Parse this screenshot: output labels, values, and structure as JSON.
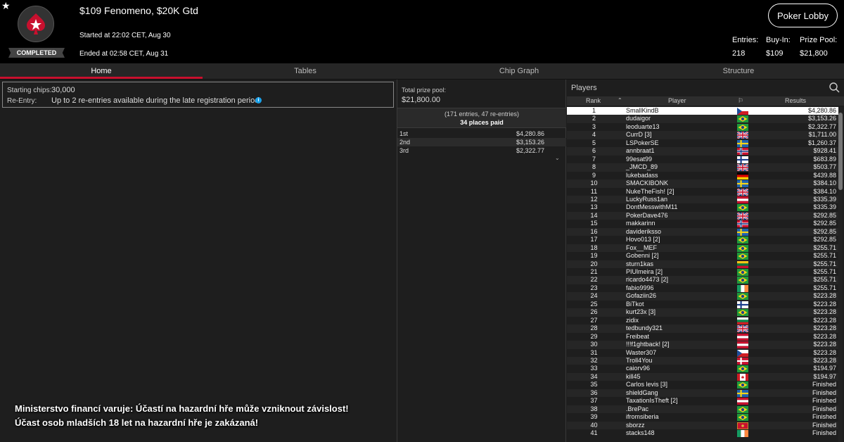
{
  "header": {
    "badge": "COMPLETED",
    "title": "$109 Fenomeno, $20K Gtd",
    "started": "Started at 22:02 CET, Aug 30",
    "ended": "Ended at 02:58 CET, Aug 31",
    "lobby_button": "Poker Lobby",
    "stats": [
      {
        "label": "Entries:",
        "value": "218"
      },
      {
        "label": "Buy-In:",
        "value": "$109"
      },
      {
        "label": "Prize Pool:",
        "value": "$21,800"
      }
    ]
  },
  "tabs": [
    "Home",
    "Tables",
    "Chip Graph",
    "Structure"
  ],
  "info": {
    "starting_chips_label": "Starting chips:",
    "starting_chips_value": "30,000",
    "reentry_label": "Re-Entry:",
    "reentry_value": "Up to 2 re-entries available during the late registration period."
  },
  "prize": {
    "label": "Total prize pool:",
    "value": "$21,800.00",
    "entries": "(171 entries, 47 re-entries)",
    "places": "34 places paid",
    "payouts": [
      {
        "place": "1st",
        "amount": "$4,280.86"
      },
      {
        "place": "2nd",
        "amount": "$3,153.26"
      },
      {
        "place": "3rd",
        "amount": "$2,322.77"
      }
    ]
  },
  "players": {
    "label": "Players",
    "col_rank": "Rank",
    "col_player": "Player",
    "col_results": "Results",
    "rows": [
      {
        "rank": "1",
        "name": "SmallKindB",
        "flag": "cz",
        "result": "$4,280.86"
      },
      {
        "rank": "2",
        "name": "dudaigor",
        "flag": "br",
        "result": "$3,153.26"
      },
      {
        "rank": "3",
        "name": "leoduarte13",
        "flag": "br",
        "result": "$2,322.77"
      },
      {
        "rank": "4",
        "name": "CurrD [3]",
        "flag": "gb",
        "result": "$1,711.00"
      },
      {
        "rank": "5",
        "name": "LSPokerSE",
        "flag": "se",
        "result": "$1,260.37"
      },
      {
        "rank": "6",
        "name": "annbraat1",
        "flag": "no",
        "result": "$928.41"
      },
      {
        "rank": "7",
        "name": "99esat99",
        "flag": "fi",
        "result": "$683.89"
      },
      {
        "rank": "8",
        "name": "_JMCD_89",
        "flag": "gb",
        "result": "$503.77"
      },
      {
        "rank": "9",
        "name": "lukebadass",
        "flag": "de",
        "result": "$439.88"
      },
      {
        "rank": "10",
        "name": "SMACKIBONK",
        "flag": "se",
        "result": "$384.10"
      },
      {
        "rank": "11",
        "name": "NukeTheFish! [2]",
        "flag": "gb",
        "result": "$384.10"
      },
      {
        "rank": "12",
        "name": "LuckyRuss1an",
        "flag": "at",
        "result": "$335.39"
      },
      {
        "rank": "13",
        "name": "DontMesswithM11",
        "flag": "br",
        "result": "$335.39"
      },
      {
        "rank": "14",
        "name": "PokerDave476",
        "flag": "gb",
        "result": "$292.85"
      },
      {
        "rank": "15",
        "name": "makkarinn",
        "flag": "no",
        "result": "$292.85"
      },
      {
        "rank": "16",
        "name": "davideriksso",
        "flag": "se",
        "result": "$292.85"
      },
      {
        "rank": "17",
        "name": "Hovo013 [2]",
        "flag": "br",
        "result": "$292.85"
      },
      {
        "rank": "18",
        "name": "Fox__MEF",
        "flag": "br",
        "result": "$255.71"
      },
      {
        "rank": "19",
        "name": "Gobenni [2]",
        "flag": "br",
        "result": "$255.71"
      },
      {
        "rank": "20",
        "name": "sturn1kas",
        "flag": "lt",
        "result": "$255.71"
      },
      {
        "rank": "21",
        "name": "PIUlmeira [2]",
        "flag": "br",
        "result": "$255.71"
      },
      {
        "rank": "22",
        "name": "ricardo4473 [2]",
        "flag": "br",
        "result": "$255.71"
      },
      {
        "rank": "23",
        "name": "fabio9996",
        "flag": "ie",
        "result": "$255.71"
      },
      {
        "rank": "24",
        "name": "Gofaziin26",
        "flag": "br",
        "result": "$223.28"
      },
      {
        "rank": "25",
        "name": "BiTkot",
        "flag": "fi",
        "result": "$223.28"
      },
      {
        "rank": "26",
        "name": "kurt23x [3]",
        "flag": "br",
        "result": "$223.28"
      },
      {
        "rank": "27",
        "name": "zidix",
        "flag": "bg",
        "result": "$223.28"
      },
      {
        "rank": "28",
        "name": "tedbundy321",
        "flag": "gb",
        "result": "$223.28"
      },
      {
        "rank": "29",
        "name": "Freibeat",
        "flag": "at",
        "result": "$223.28"
      },
      {
        "rank": "30",
        "name": "!!!f1ghtback! [2]",
        "flag": "at",
        "result": "$223.28"
      },
      {
        "rank": "31",
        "name": "Waster307",
        "flag": "cz",
        "result": "$223.28"
      },
      {
        "rank": "32",
        "name": "Troll4You",
        "flag": "dk",
        "result": "$223.28"
      },
      {
        "rank": "33",
        "name": "caiorv96",
        "flag": "br",
        "result": "$194.97"
      },
      {
        "rank": "34",
        "name": "kill45",
        "flag": "ca",
        "result": "$194.97"
      },
      {
        "rank": "35",
        "name": "Carlos levis [3]",
        "flag": "br",
        "result": "Finished"
      },
      {
        "rank": "36",
        "name": "shieldGang",
        "flag": "se",
        "result": "Finished"
      },
      {
        "rank": "37",
        "name": "TaxationIsTheft [2]",
        "flag": "at",
        "result": "Finished"
      },
      {
        "rank": "38",
        "name": ".BrePac",
        "flag": "br",
        "result": "Finished"
      },
      {
        "rank": "39",
        "name": "ifromsiberia",
        "flag": "br",
        "result": "Finished"
      },
      {
        "rank": "40",
        "name": "sborzz",
        "flag": "me",
        "result": "Finished"
      },
      {
        "rank": "41",
        "name": "stacks148",
        "flag": "ie",
        "result": "Finished"
      }
    ]
  },
  "warning": {
    "line1": "Ministerstvo financí varuje: Účastí na hazardní hře může vzniknout závislost!",
    "line2": "Účast osob mladších 18 let na hazardní hře je zakázaná!"
  }
}
